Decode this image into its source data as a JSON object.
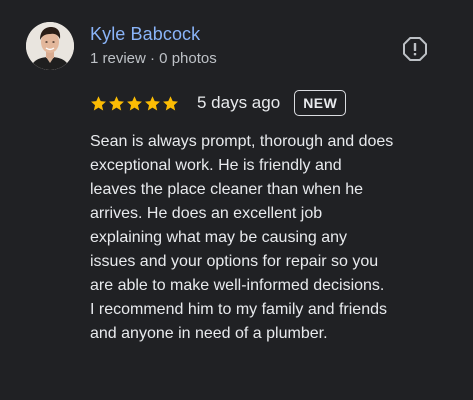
{
  "author": {
    "name": "Kyle Babcock",
    "meta": "1 review · 0 photos"
  },
  "rating": {
    "stars": 5,
    "max_stars": 5,
    "star_color": "#fbbc04"
  },
  "review": {
    "date": "5 days ago",
    "badge": "NEW",
    "text_lines": [
      "Sean is always prompt, thorough and does",
      "exceptional work. He is friendly and",
      "leaves the place cleaner than when he",
      "arrives. He does an excellent job",
      "explaining what may be causing any",
      "issues and your options for repair so you",
      "are able to make well-informed decisions.",
      "I recommend him to my family and friends",
      "and anyone in need of a plumber."
    ]
  },
  "icons": {
    "report": "report-icon",
    "star": "star-icon"
  },
  "colors": {
    "background": "#202124",
    "author_name": "#8ab4f8",
    "text": "#e8eaed",
    "secondary_text": "#bdc1c6"
  }
}
